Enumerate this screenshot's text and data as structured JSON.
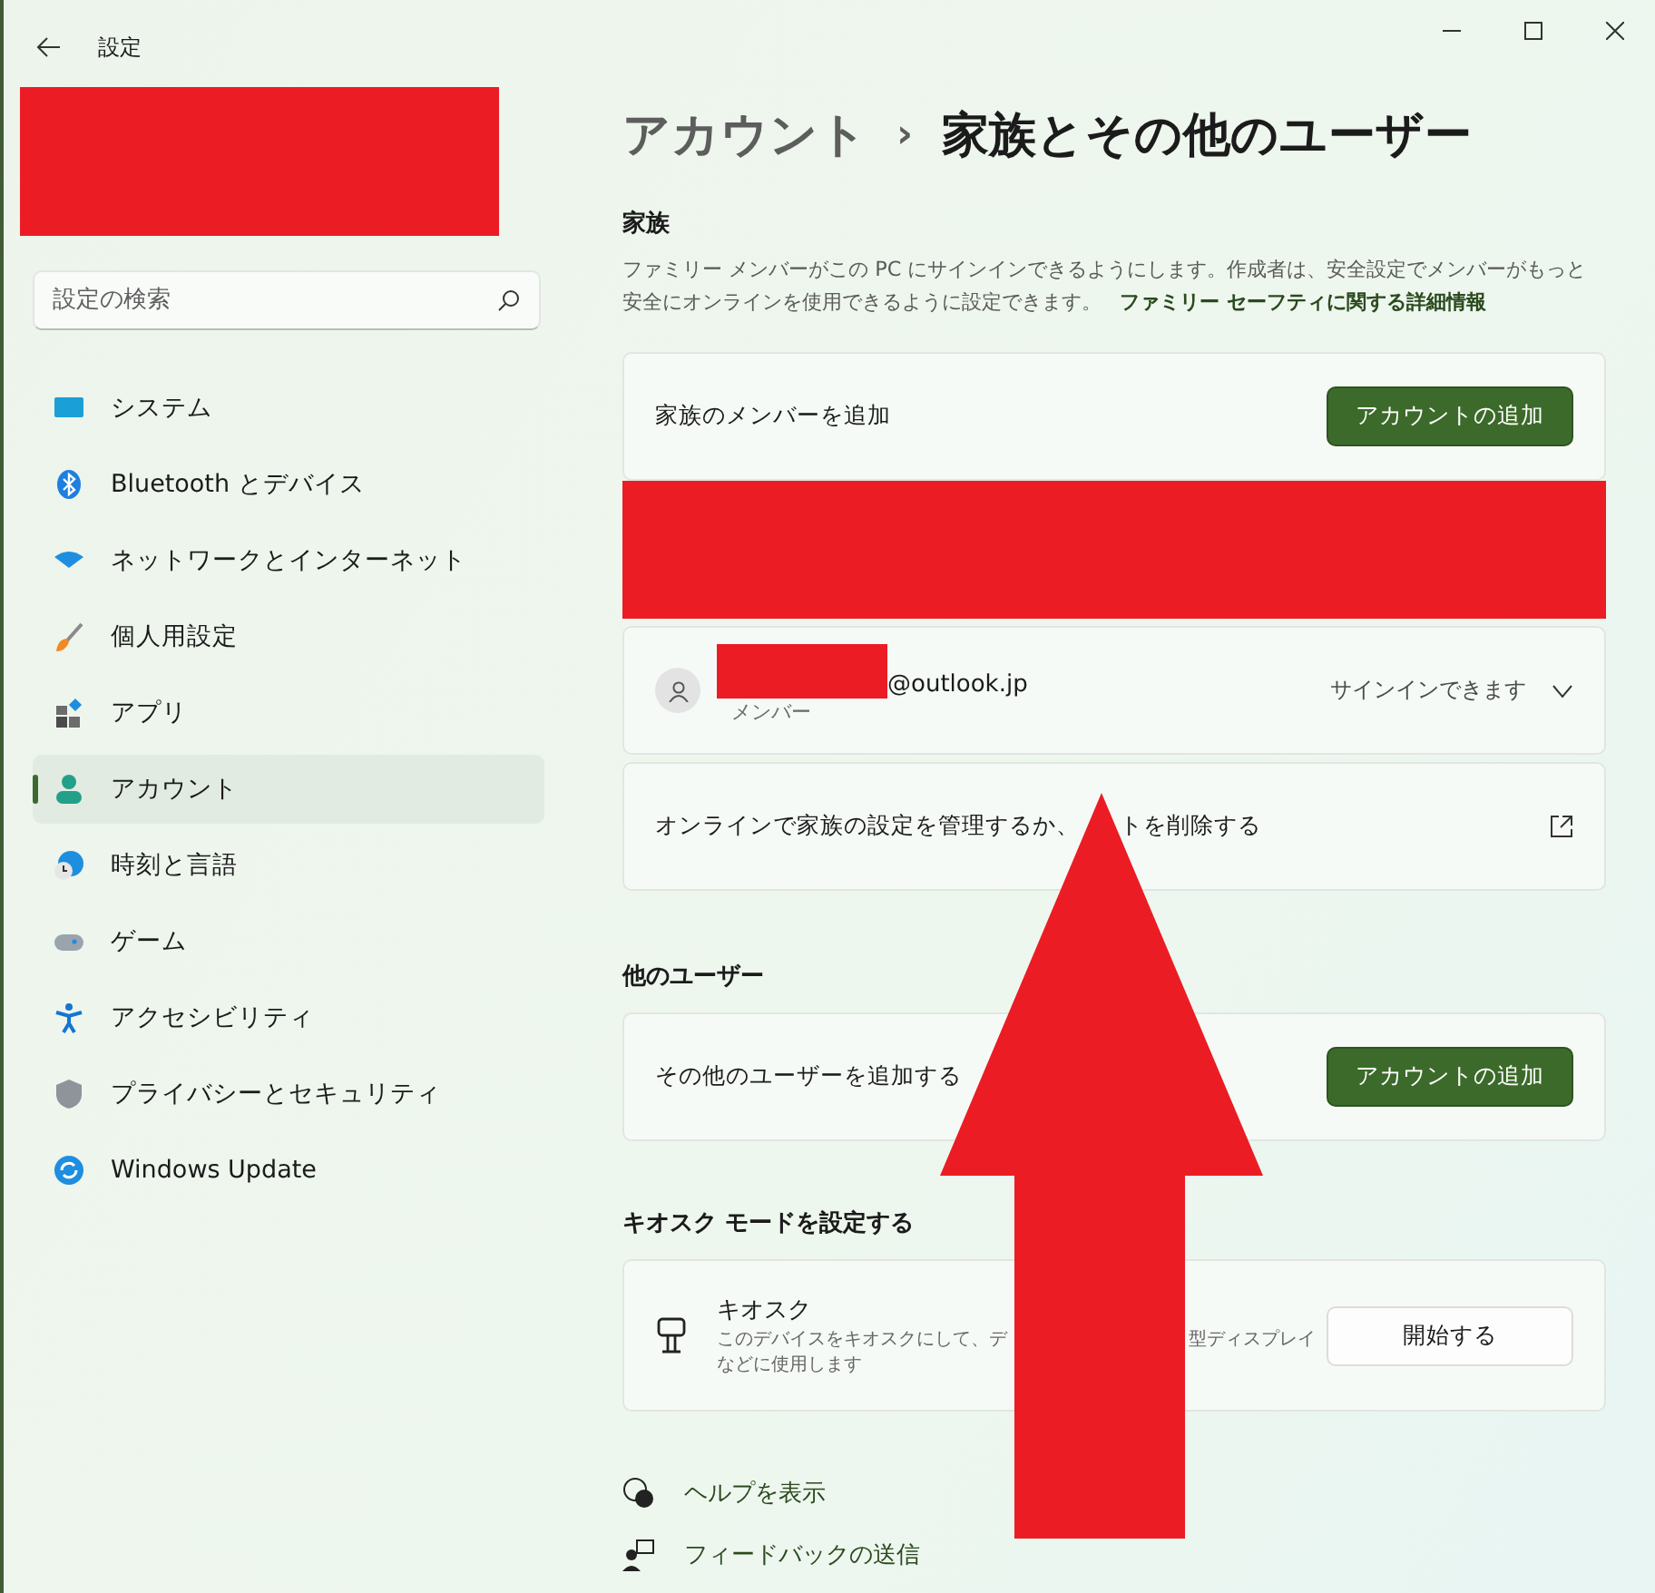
{
  "window": {
    "title": "設定"
  },
  "search": {
    "placeholder": "設定の検索"
  },
  "sidebar": {
    "items": [
      {
        "label": "システム",
        "selected": false
      },
      {
        "label": "Bluetooth とデバイス",
        "selected": false
      },
      {
        "label": "ネットワークとインターネット",
        "selected": false
      },
      {
        "label": "個人用設定",
        "selected": false
      },
      {
        "label": "アプリ",
        "selected": false
      },
      {
        "label": "アカウント",
        "selected": true
      },
      {
        "label": "時刻と言語",
        "selected": false
      },
      {
        "label": "ゲーム",
        "selected": false
      },
      {
        "label": "アクセシビリティ",
        "selected": false
      },
      {
        "label": "プライバシーとセキュリティ",
        "selected": false
      },
      {
        "label": "Windows Update",
        "selected": false
      }
    ]
  },
  "breadcrumb": {
    "parent": "アカウント",
    "separator": "›",
    "current": "家族とその他のユーザー"
  },
  "family": {
    "heading": "家族",
    "description": "ファミリー メンバーがこの PC にサインインできるようにします。作成者は、安全設定でメンバーがもっと安全にオンラインを使用できるように設定できます。",
    "link": "ファミリー セーフティに関する詳細情報",
    "add_row": {
      "label": "家族のメンバーを追加",
      "button": "アカウントの追加"
    },
    "member": {
      "email": "@outlook.jp",
      "role": "メンバー",
      "status": "サインインできます",
      "expanded": false
    },
    "manage_row": {
      "label_parts": [
        "オンラインで家族の設定を管理するか、",
        "トを削除する"
      ]
    }
  },
  "other_users": {
    "heading": "他のユーザー",
    "label": "その他のユーザーを追加する",
    "button": "アカウントの追加"
  },
  "kiosk": {
    "heading": "キオスク モードを設定する",
    "title": "キオスク",
    "description_parts": [
      "このデバイスをキオスクにして、デ",
      "型ディスプレイ"
    ],
    "description_line2": "などに使用します",
    "button": "開始する"
  },
  "footer_links": [
    "ヘルプを表示",
    "フィードバックの送信"
  ]
}
